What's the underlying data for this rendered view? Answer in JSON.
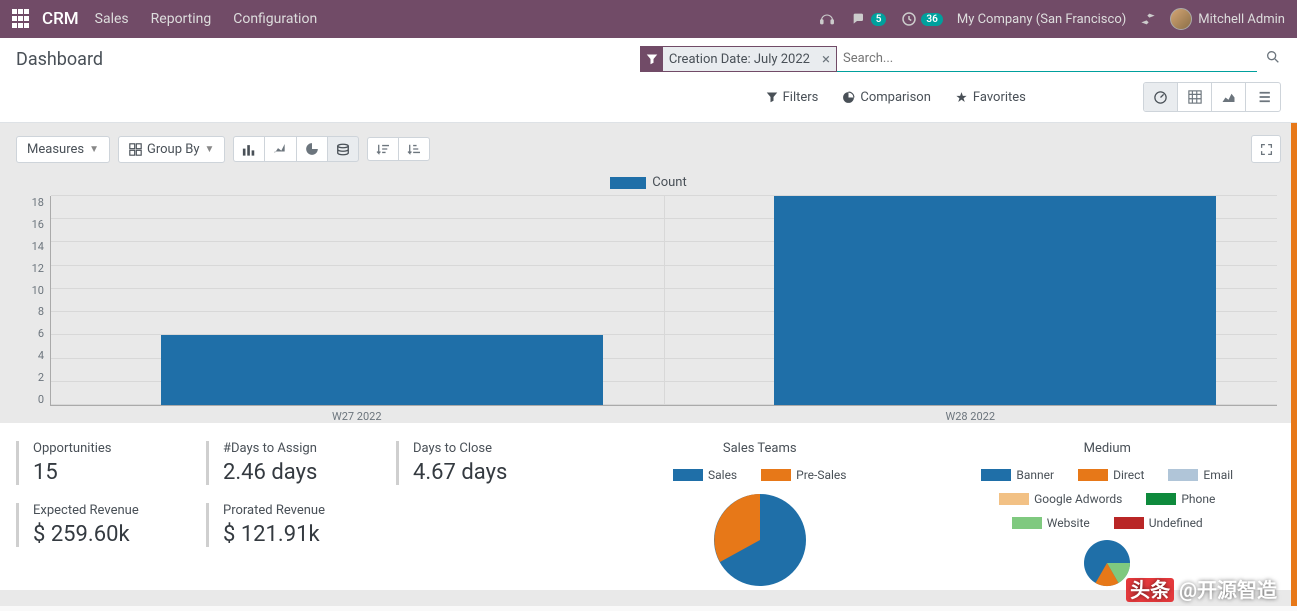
{
  "navbar": {
    "brand": "CRM",
    "links": [
      "Sales",
      "Reporting",
      "Configuration"
    ],
    "msg_badge": "5",
    "activity_badge": "36",
    "company": "My Company (San Francisco)",
    "user": "Mitchell Admin"
  },
  "header": {
    "title": "Dashboard",
    "facet_label": "Creation Date: July 2022",
    "search_placeholder": "Search...",
    "filters_label": "Filters",
    "comparison_label": "Comparison",
    "favorites_label": "Favorites"
  },
  "toolbar": {
    "measures": "Measures",
    "groupby": "Group By"
  },
  "chart_data": {
    "type": "bar",
    "categories": [
      "W27 2022",
      "W28 2022"
    ],
    "values": [
      6,
      18
    ],
    "legend": "Count",
    "ylim": [
      0,
      18
    ],
    "yticks": [
      0,
      2,
      4,
      6,
      8,
      10,
      12,
      14,
      16,
      18
    ]
  },
  "kpis": {
    "opportunities": {
      "label": "Opportunities",
      "value": "15"
    },
    "days_assign": {
      "label": "#Days to Assign",
      "value": "2.46 days"
    },
    "days_close": {
      "label": "Days to Close",
      "value": "4.67 days"
    },
    "expected": {
      "label": "Expected Revenue",
      "value": "$ 259.60k"
    },
    "prorated": {
      "label": "Prorated Revenue",
      "value": "$ 121.91k"
    }
  },
  "pie_teams": {
    "title": "Sales Teams",
    "legend": [
      {
        "name": "Sales",
        "color": "#1f6fa8"
      },
      {
        "name": "Pre-Sales",
        "color": "#e77818"
      }
    ]
  },
  "pie_medium": {
    "title": "Medium",
    "legend": [
      {
        "name": "Banner",
        "color": "#1f6fa8"
      },
      {
        "name": "Direct",
        "color": "#e77818"
      },
      {
        "name": "Email",
        "color": "#b0c5d8"
      },
      {
        "name": "Google Adwords",
        "color": "#f2c185"
      },
      {
        "name": "Phone",
        "color": "#0e8a3c"
      },
      {
        "name": "Website",
        "color": "#7fc97f"
      },
      {
        "name": "Undefined",
        "color": "#b92626"
      }
    ]
  },
  "watermark": "头条 @开源智造"
}
